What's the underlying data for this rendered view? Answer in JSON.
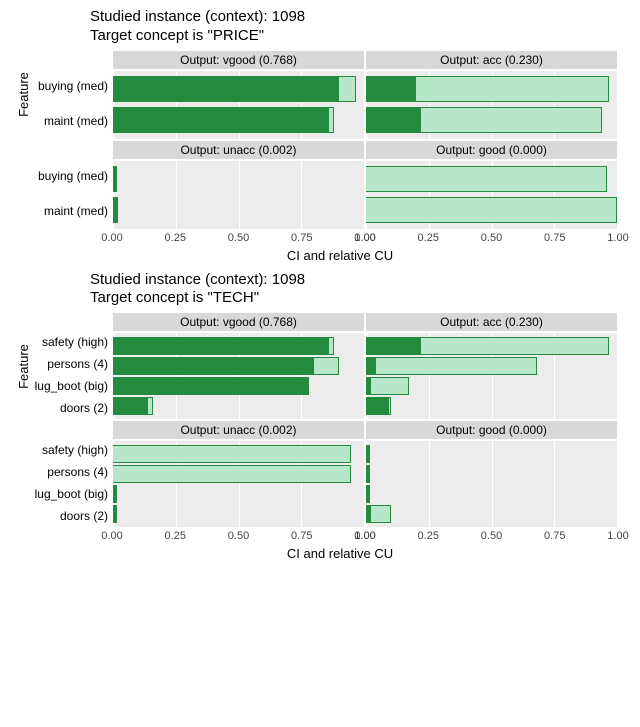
{
  "chart_data": [
    {
      "type": "bar",
      "title": "Studied instance (context): 1098\nTarget concept is \"PRICE\"",
      "xlabel": "CI and relative CU",
      "ylabel": "Feature",
      "xlim": [
        0,
        1
      ],
      "ticks": [
        0.0,
        0.25,
        0.5,
        0.75,
        1.0
      ],
      "features": [
        "buying (med)",
        "maint (med)"
      ],
      "facets": [
        [
          {
            "label": "Output: vgood (0.768)",
            "series": [
              {
                "feature": "buying (med)",
                "outer": 0.97,
                "inner": 0.9
              },
              {
                "feature": "maint (med)",
                "outer": 0.88,
                "inner": 0.86
              }
            ]
          },
          {
            "label": "Output: acc (0.230)",
            "series": [
              {
                "feature": "buying (med)",
                "outer": 0.97,
                "inner": 0.2
              },
              {
                "feature": "maint (med)",
                "outer": 0.94,
                "inner": 0.22
              }
            ]
          }
        ],
        [
          {
            "label": "Output: unacc (0.002)",
            "series": [
              {
                "feature": "buying (med)",
                "outer": 0.015,
                "inner": 0.015
              },
              {
                "feature": "maint (med)",
                "outer": 0.02,
                "inner": 0.02
              }
            ]
          },
          {
            "label": "Output: good (0.000)",
            "series": [
              {
                "feature": "buying (med)",
                "outer": 0.96,
                "inner": 0.0
              },
              {
                "feature": "maint (med)",
                "outer": 1.0,
                "inner": 0.0
              }
            ]
          }
        ]
      ]
    },
    {
      "type": "bar",
      "title": "Studied instance (context): 1098\nTarget concept is \"TECH\"",
      "xlabel": "CI and relative CU",
      "ylabel": "Feature",
      "xlim": [
        0,
        1
      ],
      "ticks": [
        0.0,
        0.25,
        0.5,
        0.75,
        1.0
      ],
      "features": [
        "safety (high)",
        "persons (4)",
        "lug_boot (big)",
        "doors (2)"
      ],
      "facets": [
        [
          {
            "label": "Output: vgood (0.768)",
            "series": [
              {
                "feature": "safety (high)",
                "outer": 0.88,
                "inner": 0.86
              },
              {
                "feature": "persons (4)",
                "outer": 0.9,
                "inner": 0.8
              },
              {
                "feature": "lug_boot (big)",
                "outer": 0.78,
                "inner": 0.78
              },
              {
                "feature": "doors (2)",
                "outer": 0.16,
                "inner": 0.14
              }
            ]
          },
          {
            "label": "Output: acc (0.230)",
            "series": [
              {
                "feature": "safety (high)",
                "outer": 0.97,
                "inner": 0.22
              },
              {
                "feature": "persons (4)",
                "outer": 0.68,
                "inner": 0.04
              },
              {
                "feature": "lug_boot (big)",
                "outer": 0.17,
                "inner": 0.02
              },
              {
                "feature": "doors (2)",
                "outer": 0.1,
                "inner": 0.09
              }
            ]
          }
        ],
        [
          {
            "label": "Output: unacc (0.002)",
            "series": [
              {
                "feature": "safety (high)",
                "outer": 0.95,
                "inner": 0.0
              },
              {
                "feature": "persons (4)",
                "outer": 0.95,
                "inner": 0.0
              },
              {
                "feature": "lug_boot (big)",
                "outer": 0.015,
                "inner": 0.015
              },
              {
                "feature": "doors (2)",
                "outer": 0.015,
                "inner": 0.015
              }
            ]
          },
          {
            "label": "Output: good (0.000)",
            "series": [
              {
                "feature": "safety (high)",
                "outer": 0.015,
                "inner": 0.015
              },
              {
                "feature": "persons (4)",
                "outer": 0.015,
                "inner": 0.015
              },
              {
                "feature": "lug_boot (big)",
                "outer": 0.015,
                "inner": 0.015
              },
              {
                "feature": "doors (2)",
                "outer": 0.1,
                "inner": 0.02
              }
            ]
          }
        ]
      ]
    }
  ],
  "tick_labels": [
    "0.00",
    "0.25",
    "0.50",
    "0.75",
    "1.00"
  ]
}
